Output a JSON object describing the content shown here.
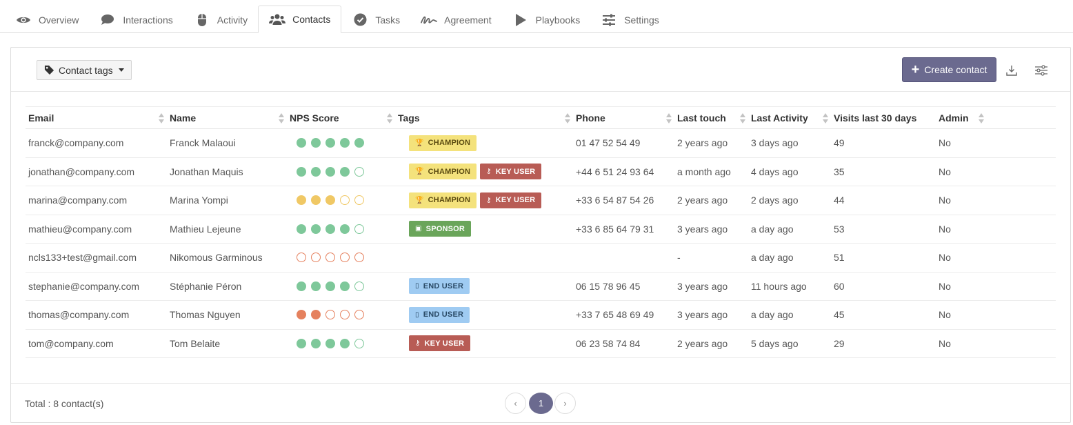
{
  "tabs": [
    {
      "label": "Overview",
      "icon": "eye-icon",
      "active": false
    },
    {
      "label": "Interactions",
      "icon": "chat-bubble-icon",
      "active": false
    },
    {
      "label": "Activity",
      "icon": "mouse-icon",
      "active": false
    },
    {
      "label": "Contacts",
      "icon": "users-icon",
      "active": true
    },
    {
      "label": "Tasks",
      "icon": "check-circle-icon",
      "active": false
    },
    {
      "label": "Agreement",
      "icon": "signature-icon",
      "active": false
    },
    {
      "label": "Playbooks",
      "icon": "play-icon",
      "active": false
    },
    {
      "label": "Settings",
      "icon": "sliders-icon",
      "active": false
    }
  ],
  "toolbar": {
    "tags_label": "Contact tags",
    "create_label": "Create contact",
    "download_icon": "download-icon",
    "columns_icon": "sliders-icon"
  },
  "colors": {
    "accent": "#6b6a8f",
    "nps_green": "#7ec89a",
    "nps_yellow": "#f0c865",
    "nps_orange": "#e5815e",
    "champion_bg": "#f4e27c",
    "key_user_bg": "#b85c55",
    "sponsor_bg": "#6aa55a",
    "end_user_bg": "#9fcbf2"
  },
  "columns": [
    "Email",
    "Name",
    "NPS Score",
    "Tags",
    "Phone",
    "Last touch",
    "Last Activity",
    "Visits last 30 days",
    "Admin"
  ],
  "tag_types": {
    "CHAMPION": {
      "icon": "trophy-icon",
      "glyph": "🏆",
      "bg": "#f4e27c",
      "fg": "#5a4a10"
    },
    "KEY USER": {
      "icon": "key-icon",
      "glyph": "⚷",
      "bg": "#b85c55",
      "fg": "#ffffff"
    },
    "SPONSOR": {
      "icon": "money-icon",
      "glyph": "▣",
      "bg": "#6aa55a",
      "fg": "#ffffff"
    },
    "END USER": {
      "icon": "mobile-icon",
      "glyph": "▯",
      "bg": "#9fcbf2",
      "fg": "#2a4a66"
    }
  },
  "rows": [
    {
      "email": "franck@company.com",
      "name": "Franck Malaoui",
      "nps": 5,
      "nps_color": "green",
      "tags": [
        "CHAMPION"
      ],
      "phone": "01 47 52 54 49",
      "last_touch": "2 years ago",
      "last_activity": "3 days ago",
      "visits": "49",
      "admin": "No"
    },
    {
      "email": "jonathan@company.com",
      "name": "Jonathan Maquis",
      "nps": 4,
      "nps_color": "green",
      "tags": [
        "CHAMPION",
        "KEY USER"
      ],
      "phone": "+44 6 51 24 93 64",
      "last_touch": "a month ago",
      "last_activity": "4 days ago",
      "visits": "35",
      "admin": "No"
    },
    {
      "email": "marina@company.com",
      "name": "Marina Yompi",
      "nps": 3,
      "nps_color": "yellow",
      "tags": [
        "CHAMPION",
        "KEY USER"
      ],
      "phone": "+33 6 54 87 54 26",
      "last_touch": "2 years ago",
      "last_activity": "2 days ago",
      "visits": "44",
      "admin": "No"
    },
    {
      "email": "mathieu@company.com",
      "name": "Mathieu Lejeune",
      "nps": 4,
      "nps_color": "green",
      "tags": [
        "SPONSOR"
      ],
      "phone": "+33 6 85 64 79 31",
      "last_touch": "3 years ago",
      "last_activity": "a day ago",
      "visits": "53",
      "admin": "No"
    },
    {
      "email": "ncls133+test@gmail.com",
      "name": "Nikomous Garminous",
      "nps": 0,
      "nps_color": "orange",
      "tags": [],
      "phone": "",
      "last_touch": "-",
      "last_activity": "a day ago",
      "visits": "51",
      "admin": "No"
    },
    {
      "email": "stephanie@company.com",
      "name": "Stéphanie Péron",
      "nps": 4,
      "nps_color": "green",
      "tags": [
        "END USER"
      ],
      "phone": "06 15 78 96 45",
      "last_touch": "3 years ago",
      "last_activity": "11 hours ago",
      "visits": "60",
      "admin": "No"
    },
    {
      "email": "thomas@company.com",
      "name": "Thomas Nguyen",
      "nps": 2,
      "nps_color": "orange",
      "tags": [
        "END USER"
      ],
      "phone": "+33 7 65 48 69 49",
      "last_touch": "3 years ago",
      "last_activity": "a day ago",
      "visits": "45",
      "admin": "No"
    },
    {
      "email": "tom@company.com",
      "name": "Tom Belaite",
      "nps": 4,
      "nps_color": "green",
      "tags": [
        "KEY USER"
      ],
      "phone": "06 23 58 74 84",
      "last_touch": "2 years ago",
      "last_activity": "5 days ago",
      "visits": "29",
      "admin": "No"
    }
  ],
  "footer": {
    "total": "Total : 8 contact(s)",
    "prev": "‹",
    "page": "1",
    "next": "›"
  }
}
